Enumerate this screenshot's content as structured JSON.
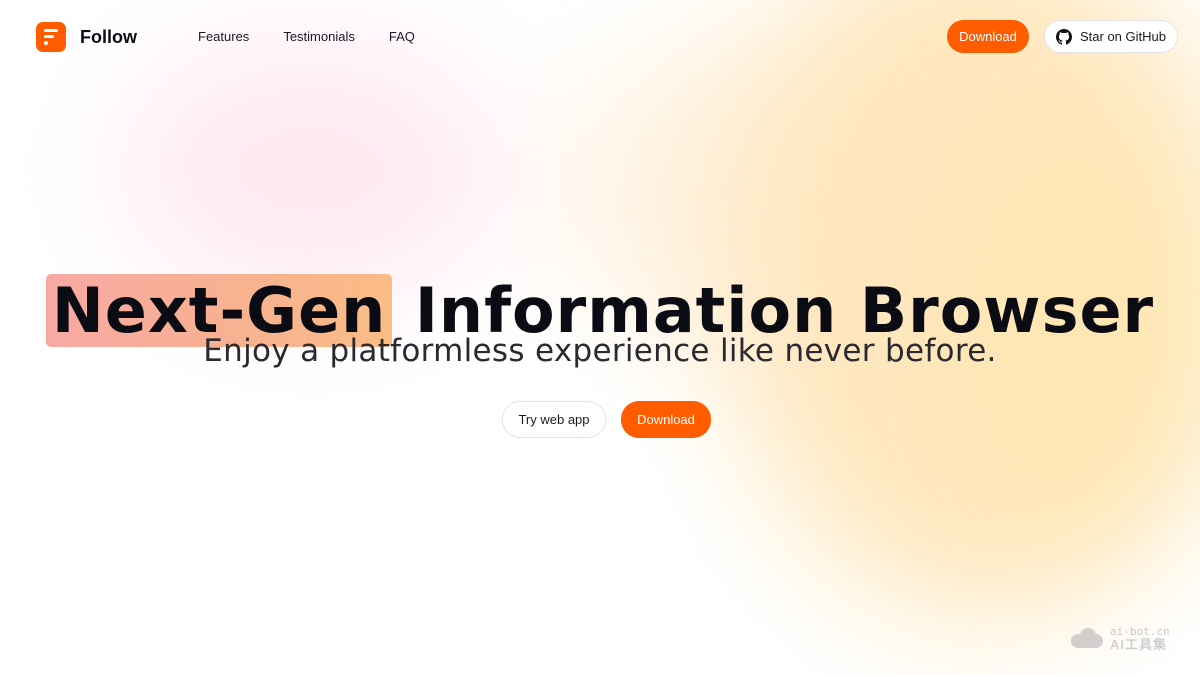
{
  "header": {
    "brand_name": "Follow",
    "nav": [
      {
        "label": "Features"
      },
      {
        "label": "Testimonials"
      },
      {
        "label": "FAQ"
      }
    ],
    "download_label": "Download",
    "github_label": "Star on GitHub"
  },
  "hero": {
    "title_highlight": "Next-Gen",
    "title_rest": "Information Browser",
    "subtitle": "Enjoy a platformless experience like never before.",
    "web_app_label": "Try web app",
    "download_label": "Download"
  },
  "watermark": {
    "url": "ai-bot.cn",
    "name": "AI工具集"
  },
  "colors": {
    "accent": "#ff5c00",
    "text": "#0b0b14"
  },
  "icons": {
    "logo": "follow-logo-icon",
    "github": "github-icon",
    "watermark": "cloud-icon"
  }
}
